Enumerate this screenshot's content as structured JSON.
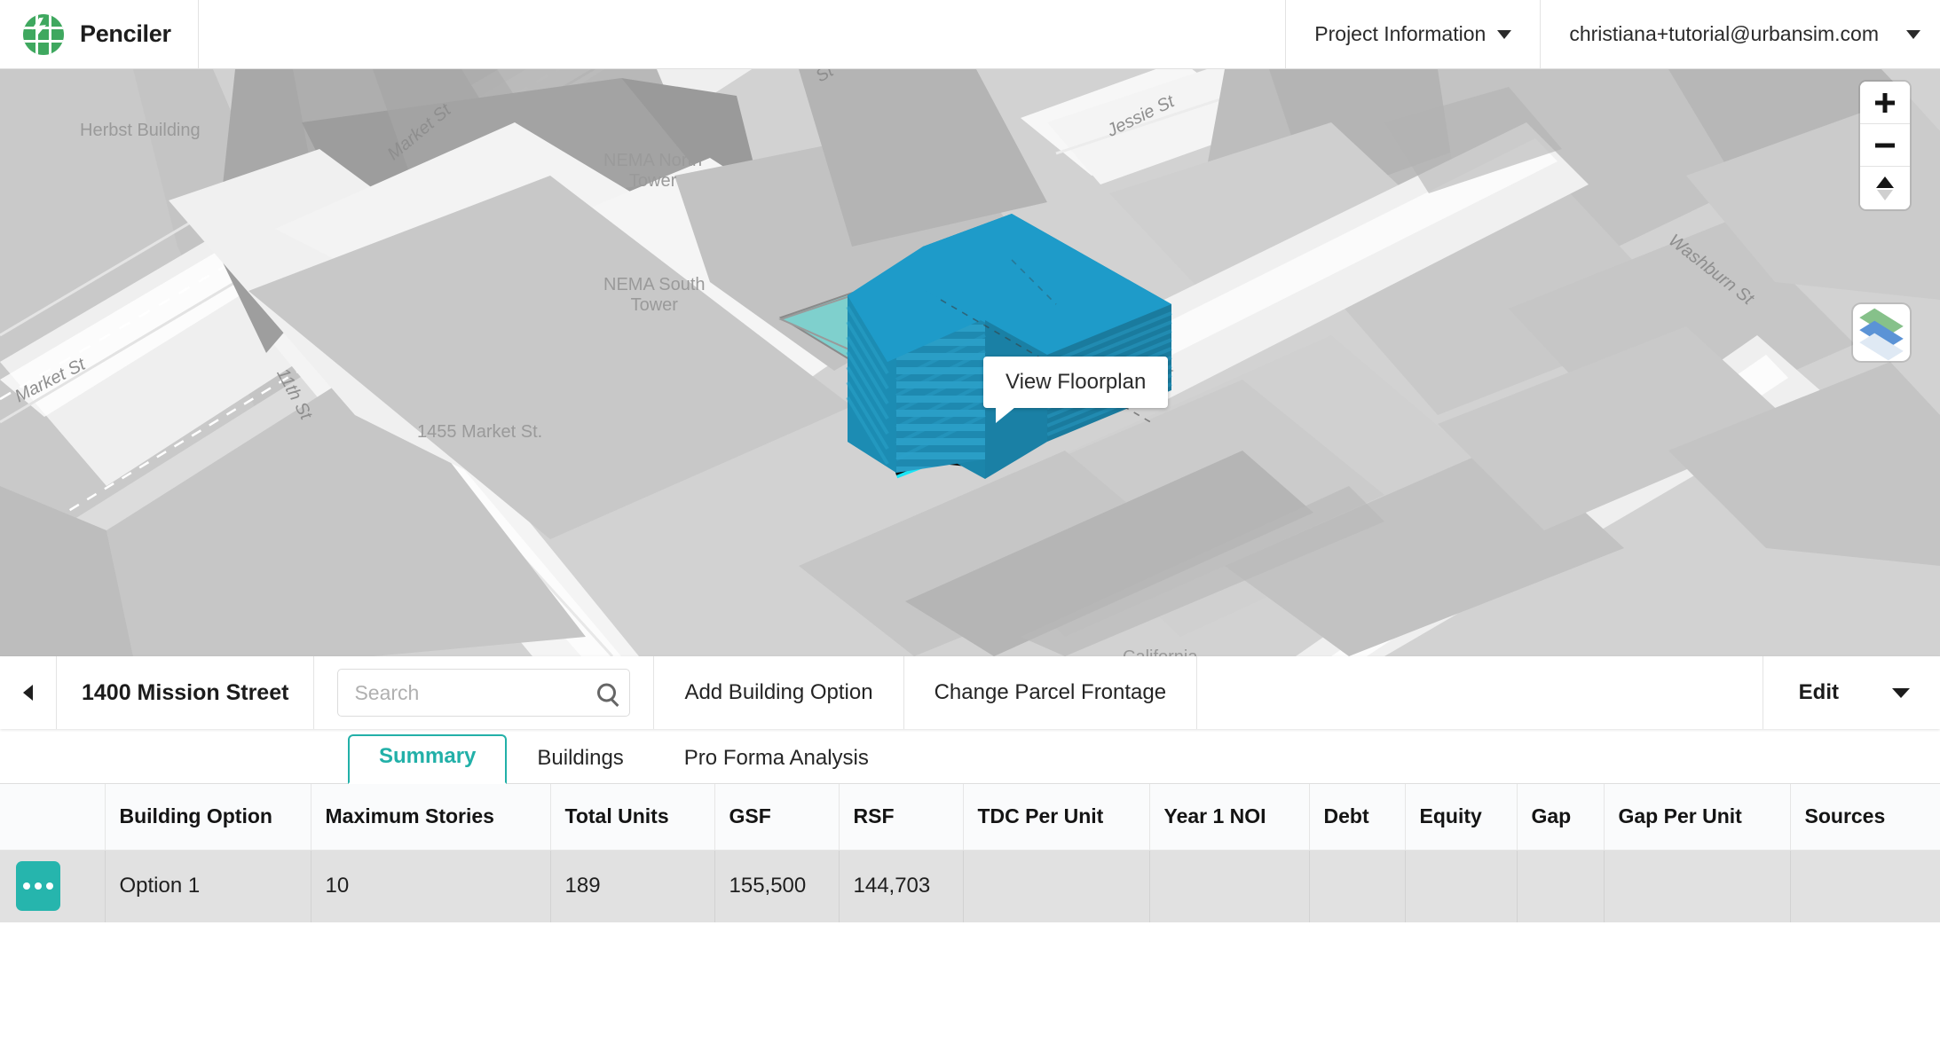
{
  "header": {
    "brand": "Penciler",
    "logo_icon": "globe-grid-icon",
    "project_menu": "Project Information",
    "user_email": "christiana+tutorial@urbansim.com",
    "accent_green": "#3fa85f"
  },
  "map": {
    "labels": [
      {
        "text": "Herbst Building",
        "kind": "building"
      },
      {
        "text": "Market St",
        "kind": "street"
      },
      {
        "text": "Market St",
        "kind": "street"
      },
      {
        "text": "11th St",
        "kind": "street"
      },
      {
        "text": "NEMA North\nTower",
        "kind": "building"
      },
      {
        "text": "NEMA South\nTower",
        "kind": "building"
      },
      {
        "text": "1455 Market St.",
        "kind": "building"
      },
      {
        "text": "Jessie St",
        "kind": "street"
      },
      {
        "text": "Washburn St",
        "kind": "street"
      },
      {
        "text": "California",
        "kind": "building"
      },
      {
        "text": "St",
        "kind": "street"
      }
    ],
    "tooltip": "View Floorplan",
    "controls": {
      "zoom_in": "plus-icon",
      "zoom_out": "minus-icon",
      "compass": "compass-icon",
      "layers": "layers-icon"
    },
    "building_color": "#1e9bc9",
    "parcel_color": "#7fd0cd",
    "highlight_color": "#19e5f5"
  },
  "toolbar": {
    "back_icon": "chevron-left-icon",
    "title": "1400 Mission Street",
    "search_placeholder": "Search",
    "search_value": "",
    "search_icon": "search-icon",
    "add_building_option": "Add Building Option",
    "change_parcel_frontage": "Change Parcel Frontage",
    "edit_label": "Edit",
    "edit_caret": "chevron-down-icon"
  },
  "tabs": [
    {
      "label": "Summary",
      "active": true
    },
    {
      "label": "Buildings",
      "active": false
    },
    {
      "label": "Pro Forma Analysis",
      "active": false
    }
  ],
  "table": {
    "columns": [
      "",
      "Building Option",
      "Maximum Stories",
      "Total Units",
      "GSF",
      "RSF",
      "TDC Per Unit",
      "Year 1 NOI",
      "Debt",
      "Equity",
      "Gap",
      "Gap Per Unit",
      "Sources"
    ],
    "rows": [
      {
        "action_icon": "ellipsis-icon",
        "building_option": "Option 1",
        "maximum_stories": "10",
        "total_units": "189",
        "gsf": "155,500",
        "rsf": "144,703",
        "tdc_per_unit": "",
        "year_1_noi": "",
        "debt": "",
        "equity": "",
        "gap": "",
        "gap_per_unit": "",
        "sources": ""
      }
    ]
  },
  "colors": {
    "teal": "#26b5ad",
    "tab_active": "#22b0a8"
  }
}
